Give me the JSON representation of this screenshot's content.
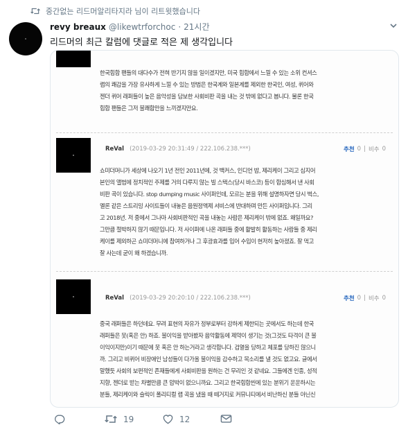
{
  "retweet_notice": "중간없는 리드머알리타지라 님이 리트윗했습니다",
  "tweet": {
    "display_name": "revy breaux",
    "handle": "@likewtrforchoc",
    "separator": "·",
    "time": "21시간",
    "text": "리드머의 최근 칼럼에 댓글로 적은 제 생각입니다"
  },
  "comments": [
    {
      "lines": [
        "한국힙합 팬들의 대다수가 전혀 반기지 않을 일이겠지만, 미국 힙합에서 느낄 수 있는 소위 컨셔스",
        "랩의 쾌감을 가장 유사하게 느낄 수 있는 방법은 한국계와 일본계를 제외한 한국인, 여성, 퀴어와",
        "젠더 퀴어 래퍼들이 높은 음악성을 담보한 사회비판 곡을 내는 것 밖에 없다고 봅니다. 물론 한국",
        "힙합 팬들은 그저 불쾌함만을 느끼겠지만요."
      ]
    },
    {
      "author": "ReVal",
      "date": "(2019-03-29 20:31:49 / 222.106.238.***)",
      "recommend_label": "추천",
      "recommend_count": "0",
      "pipe": "|",
      "oppose_label": "비추",
      "oppose_count": "0",
      "lines": [
        "쇼미더머니가 세상에 나오기 1년 전인 2011년에, 것 백커스, 인디언 밥, 제리케이 그리고 심지어",
        "본인의 앨범에 정치적인 주제를 거의 다루지 않는 빌 스택스(당시 바스코) 등이 합심해서 낸 사회",
        "비판 곡이 있습니다. stop dumping music 사이퍼인데, 모르는 분을 위해 설명하자면 당시 벅스,",
        "멜론 같은 스트리밍 사이트들이 내놓은 음원정액제 서비스에 반대하며 만든 사이퍼입니다. 그리",
        "고 2018년. 저 중에서 그나마 사회비판적인 곡을 내놓는 사람은 제리케이 밖에 없죠. 왜일까요?",
        "그만큼 절박하지 않기 때문입니다. 저 사이퍼에 나온 래퍼들 중에 활발히 활동하는 사람들 중 제리",
        "케이를 제외하곤 쇼미더머니에 참여하거나 그 후광효과를 입어 수입이 현저히 높아졌죠. 잘 먹고",
        "잘 사는데 굳이 왜 하겠습니까."
      ]
    },
    {
      "author": "ReVal",
      "date": "(2019-03-29 20:20:10 / 222.106.238.***)",
      "recommend_label": "추천",
      "recommend_count": "0",
      "pipe": "|",
      "oppose_label": "비추",
      "oppose_count": "0",
      "lines": [
        "중국 래퍼들은 하던데요. 무려 표현의 자유가 정부로부터 강하게 제한되는 곳에서도 하는데 한국",
        "래퍼들은 못(혹은 안) 하죠. 불이익을 받아봤자 음악활동에 제약이 생기는 것(그것도 타격이 큰 불",
        "이익이지만)이기 때문에 못 혹은 안 하는거라고 생각합니다. 검열을 당하고 체포를 당하진 않으니",
        "까. 그리고 비퀴어 비장애인 남성들이 다가올 불이익을 감수하고 목소리를 낼 것도 없고요. 글에서",
        "말했듯 사회의 보편적인 존재들에게 사회비판을 원하는 건 무리인 것 같네요. 그들에겐 인종, 성적",
        "지향, 젠더로 받는 차별만큼 큰 압박이 없으니까요. 그리고 한국힙합씬에 있는 분위기 운운하시는",
        "분들, 제리케이와 슬릭이 폴리티컬 랩 곡을 냈을 때 떼거지로 커뮤니티에서 비난하신 분들 아닌신"
      ]
    }
  ],
  "actions": {
    "reply_icon": "reply-icon",
    "retweet_icon": "retweet-icon",
    "retweet_count": "19",
    "like_icon": "heart-icon",
    "like_count": "12",
    "dm_icon": "envelope-icon"
  },
  "colors": {
    "secondary_text": "#657786",
    "recommend_blue": "#1b5fbb",
    "divider": "#e1e8ed"
  }
}
